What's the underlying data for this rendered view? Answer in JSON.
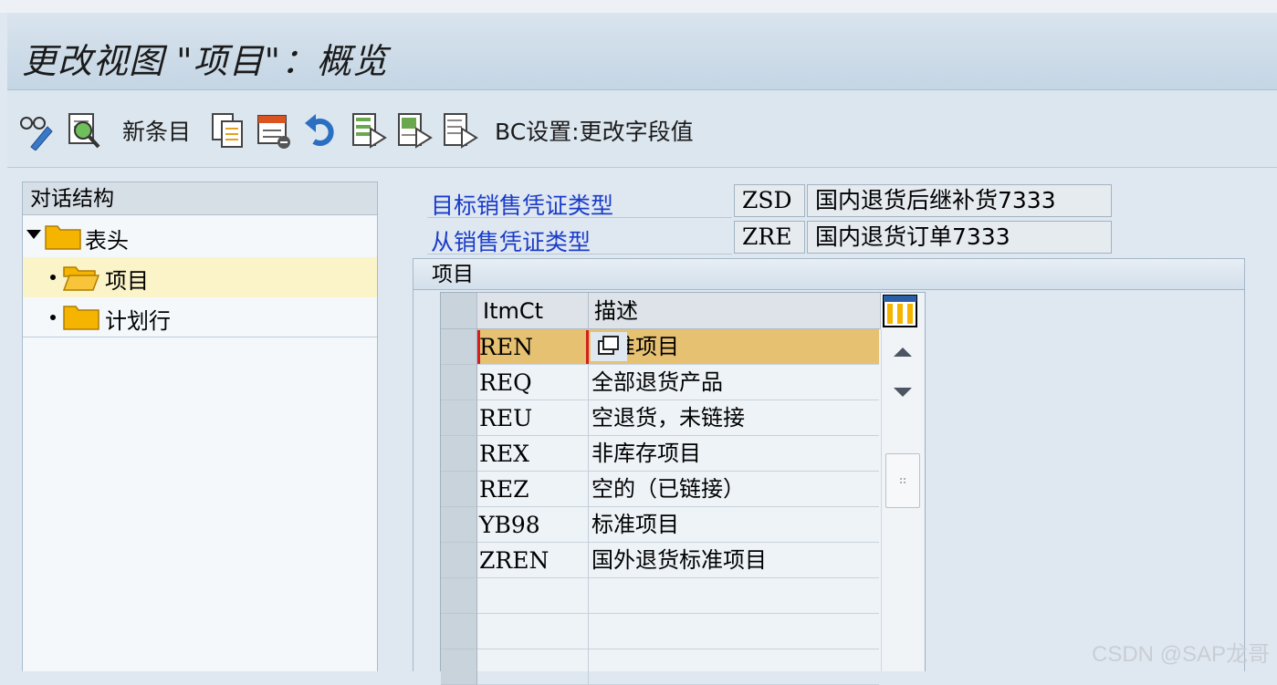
{
  "title": "更改视图 \"项目\"：概览",
  "toolbar": {
    "new_entries_label": "新条目",
    "bc_set_label": "BC设置:更改字段值",
    "icons": [
      "display-change-icon",
      "detail-icon",
      "copy-icon",
      "delete-icon",
      "undo-icon",
      "select-all-icon",
      "select-block-icon",
      "deselect-all-icon"
    ]
  },
  "nav": {
    "header": "对话结构",
    "items": [
      {
        "label": "表头",
        "expanded": true
      },
      {
        "label": "项目",
        "selected": true
      },
      {
        "label": "计划行"
      }
    ]
  },
  "fields": {
    "target": {
      "label": "目标销售凭证类型",
      "code": "ZSD",
      "desc": "国内退货后继补货7333"
    },
    "source": {
      "label": "从销售凭证类型",
      "code": "ZRE",
      "desc": "国内退货订单7333"
    }
  },
  "group": {
    "title": "项目"
  },
  "table": {
    "columns": [
      "ItmCt",
      "描述"
    ],
    "rows": [
      {
        "itmct": "REN",
        "desc": "标准项目",
        "active": true
      },
      {
        "itmct": "REQ",
        "desc": "全部退货产品"
      },
      {
        "itmct": "REU",
        "desc": "空退货，未链接"
      },
      {
        "itmct": "REX",
        "desc": "非库存项目"
      },
      {
        "itmct": "REZ",
        "desc": "空的（已链接）"
      },
      {
        "itmct": "YB98",
        "desc": "标准项目"
      },
      {
        "itmct": "ZREN",
        "desc": "国外退货标准项目"
      }
    ],
    "empty_rows": 3
  },
  "watermark": "CSDN @SAP龙哥",
  "colors": {
    "link_blue": "#1b3cc8",
    "active_row": "#e7c172",
    "selected_nav": "#fbf4c8"
  }
}
